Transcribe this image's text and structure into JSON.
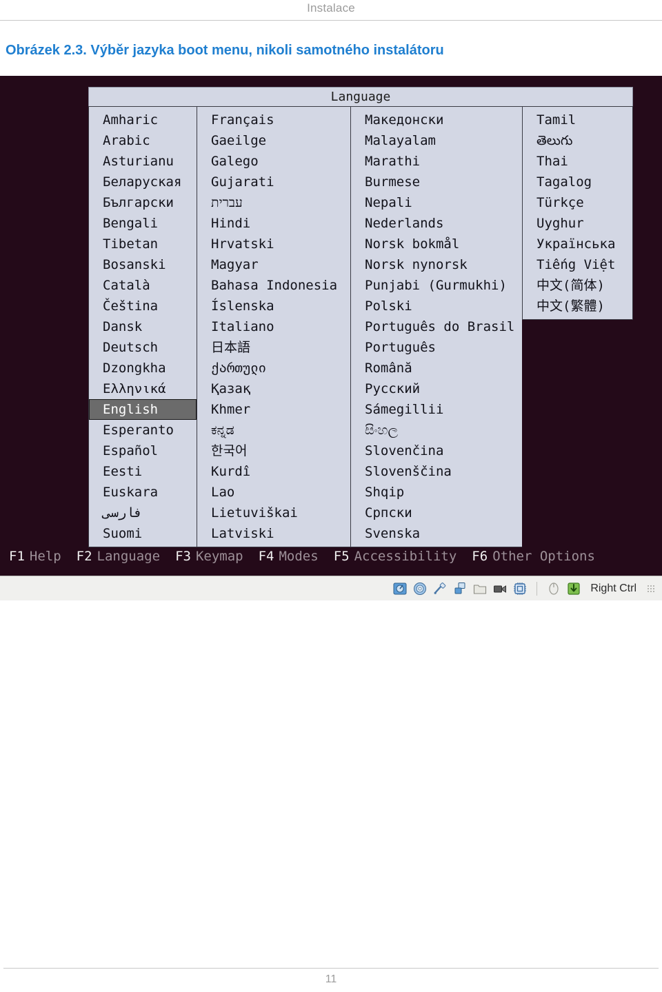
{
  "page": {
    "header_title": "Instalace",
    "figure_caption": "Obrázek 2.3. Výběr jazyka boot menu, nikoli samotného instalátoru",
    "page_number": "11"
  },
  "boot_menu": {
    "title": "Language",
    "selected_language": "English",
    "columns": [
      {
        "name": "column-1",
        "items": [
          "Amharic",
          "Arabic",
          "Asturianu",
          "Беларуская",
          "Български",
          "Bengali",
          "Tibetan",
          "Bosanski",
          "Català",
          "Čeština",
          "Dansk",
          "Deutsch",
          "Dzongkha",
          "Ελληνικά",
          "English",
          "Esperanto",
          "Español",
          "Eesti",
          "Euskara",
          "فارسی",
          "Suomi"
        ]
      },
      {
        "name": "column-2",
        "items": [
          "Français",
          "Gaeilge",
          "Galego",
          "Gujarati",
          "עברית",
          "Hindi",
          "Hrvatski",
          "Magyar",
          "Bahasa Indonesia",
          "Íslenska",
          "Italiano",
          "日本語",
          "ქართული",
          "Қазақ",
          "Khmer",
          "ಕನ್ನಡ",
          "한국어",
          "Kurdî",
          "Lao",
          "Lietuviškai",
          "Latviski"
        ]
      },
      {
        "name": "column-3",
        "items": [
          "Македонски",
          "Malayalam",
          "Marathi",
          "Burmese",
          "Nepali",
          "Nederlands",
          "Norsk bokmål",
          "Norsk nynorsk",
          "Punjabi (Gurmukhi)",
          "Polski",
          "Português do Brasil",
          "Português",
          "Română",
          "Русский",
          "Sámegillii",
          "සිංහල",
          "Slovenčina",
          "Slovenščina",
          "Shqip",
          "Српски",
          "Svenska"
        ]
      },
      {
        "name": "column-4",
        "items": [
          "Tamil",
          "తెలుగు",
          "Thai",
          "Tagalog",
          "Türkçe",
          "Uyghur",
          "Українська",
          "Tiếng Việt",
          "中文(简体)",
          "中文(繁體)"
        ]
      }
    ]
  },
  "function_keys": [
    {
      "key": "F1",
      "label": "Help"
    },
    {
      "key": "F2",
      "label": "Language"
    },
    {
      "key": "F3",
      "label": "Keymap"
    },
    {
      "key": "F4",
      "label": "Modes"
    },
    {
      "key": "F5",
      "label": "Accessibility"
    },
    {
      "key": "F6",
      "label": "Other Options"
    }
  ],
  "vbox_statusbar": {
    "icons": [
      "hard-disk-icon",
      "optical-disk-icon",
      "usb-icon",
      "network-icon",
      "shared-folder-icon",
      "video-capture-icon",
      "cpu-icon"
    ],
    "secondary_icons": [
      "mouse-integration-icon",
      "host-key-icon"
    ],
    "host_key_label": "Right Ctrl"
  },
  "colors": {
    "vm_background": "#240a19",
    "menu_background": "#d3d7e4",
    "menu_border": "#3a3a44",
    "selection_background": "#6b6b6b",
    "caption_link": "#1f7fd0",
    "fkey_key": "#f0f0f0",
    "fkey_label": "#9d9098"
  }
}
